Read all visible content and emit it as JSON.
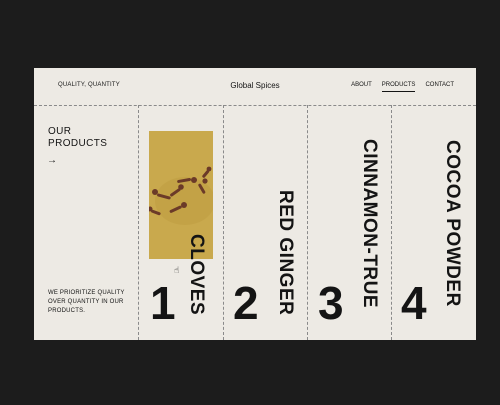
{
  "header": {
    "tagline": "QUALITY, QUANTITY",
    "brand": "Global Spices",
    "nav": [
      "ABOUT",
      "PRODUCTS",
      "CONTACT"
    ]
  },
  "intro": {
    "title_line1": "OUR",
    "title_line2": "PRODUCTS",
    "arrow": "→",
    "text": "WE PRIORITIZE QUALITY OVER QUANTITY IN OUR PRODUCTS."
  },
  "products": [
    {
      "number": "1",
      "name": "CLOVES"
    },
    {
      "number": "2",
      "name": "RED GINGER"
    },
    {
      "number": "3",
      "name": "CINNAMON-TRUE"
    },
    {
      "number": "4",
      "name": "COCOA POWDER"
    }
  ],
  "colors": {
    "background": "#1c1c1c",
    "page": "#edeae4",
    "ink": "#141414",
    "photo": "#c5a54a"
  },
  "icons": {
    "arrow": "arrow-right-icon",
    "cursor": "hand-cursor-icon"
  }
}
